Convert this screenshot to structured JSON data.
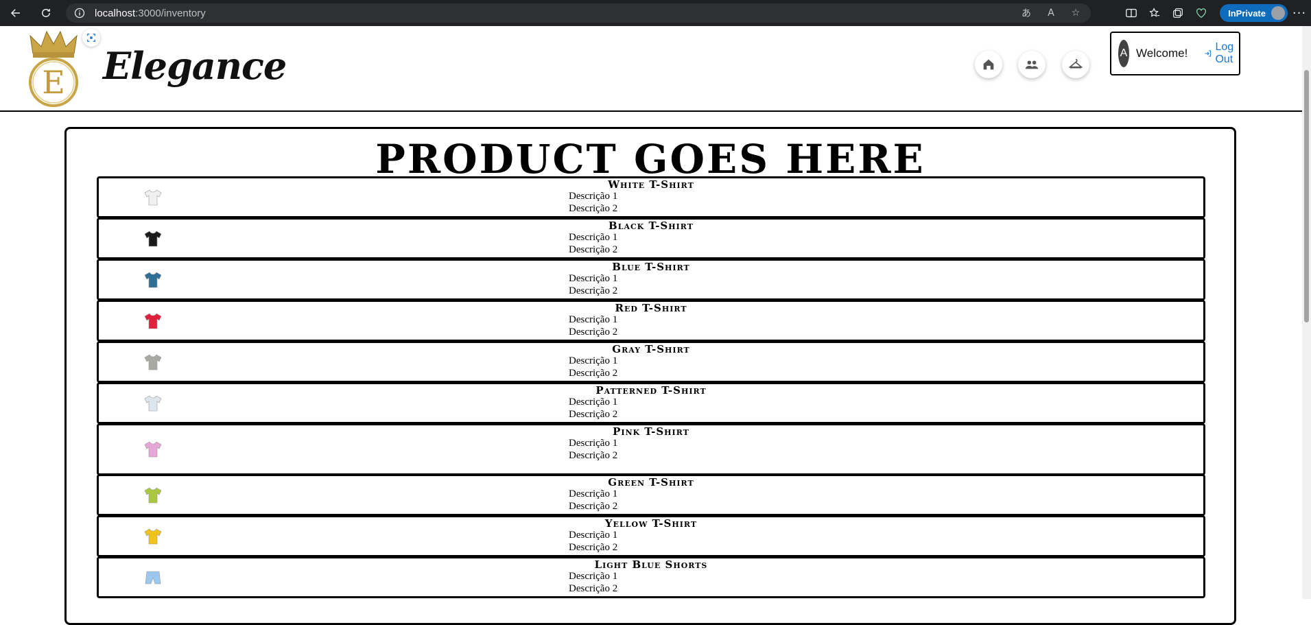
{
  "browser": {
    "url_host": "localhost",
    "url_rest": ":3000/inventory",
    "inprivate_label": "InPrivate",
    "more_label": "···"
  },
  "header": {
    "brand": "Elegance",
    "logo_letter": "E",
    "avatar_initial": "A",
    "welcome": "Welcome!",
    "logout": "Log Out"
  },
  "main": {
    "title": "PRODUCT GOES HERE",
    "products": [
      {
        "name": "White T-Shirt",
        "desc1": "Descrição 1",
        "desc2": "Descrição 2",
        "color": "#f0f0f0"
      },
      {
        "name": "Black T-Shirt",
        "desc1": "Descrição 1",
        "desc2": "Descrição 2",
        "color": "#1b1b1b"
      },
      {
        "name": "Blue T-Shirt",
        "desc1": "Descrição 1",
        "desc2": "Descrição 2",
        "color": "#2e6f93"
      },
      {
        "name": "Red T-Shirt",
        "desc1": "Descrição 1",
        "desc2": "Descrição 2",
        "color": "#e0213c"
      },
      {
        "name": "Gray T-Shirt",
        "desc1": "Descrição 1",
        "desc2": "Descrição 2",
        "color": "#a9a9a3"
      },
      {
        "name": "Patterned T-Shirt",
        "desc1": "Descrição 1",
        "desc2": "Descrição 2",
        "color": "#dde6ee"
      },
      {
        "name": "Pink T-Shirt",
        "desc1": "Descrição 1",
        "desc2": "Descrição 2",
        "color": "#e6a6d6"
      },
      {
        "name": "Green T-Shirt",
        "desc1": "Descrição 1",
        "desc2": "Descrição 2",
        "color": "#a9c83f"
      },
      {
        "name": "Yellow T-Shirt",
        "desc1": "Descrição 1",
        "desc2": "Descrição 2",
        "color": "#f1c21b"
      },
      {
        "name": "Light Blue Shorts",
        "desc1": "Descrição 1",
        "desc2": "Descrição 2",
        "color": "#9cc7ef"
      }
    ]
  }
}
